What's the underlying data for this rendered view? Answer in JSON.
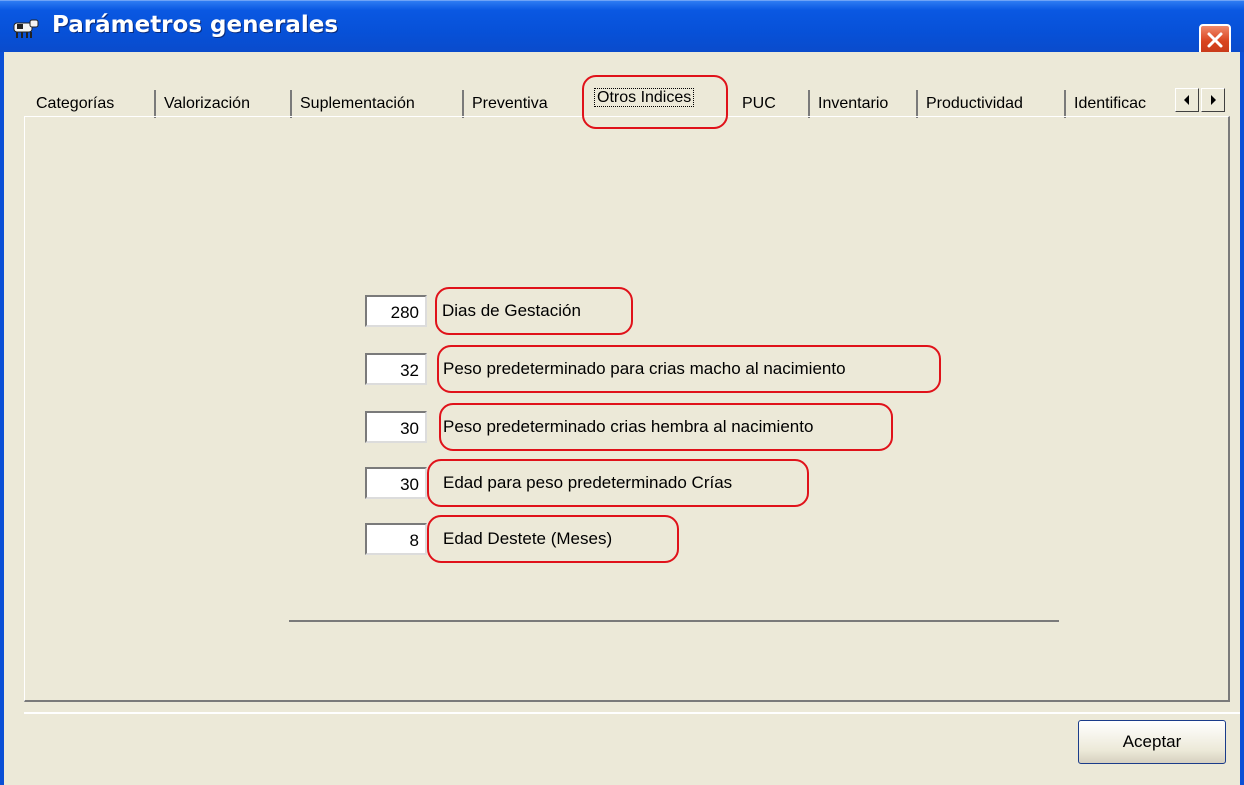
{
  "window": {
    "title": "Parámetros generales",
    "icon": "cow-icon",
    "close_icon": "close-icon"
  },
  "tabs": [
    {
      "label": "Categorías"
    },
    {
      "label": "Valorización"
    },
    {
      "label": "Suplementación"
    },
    {
      "label": "Preventiva"
    },
    {
      "label": "Otros Indices",
      "active": true
    },
    {
      "label": "PUC"
    },
    {
      "label": "Inventario"
    },
    {
      "label": "Productividad"
    },
    {
      "label": "Identificac"
    }
  ],
  "tab_scroll": {
    "left_icon": "arrow-left-icon",
    "right_icon": "arrow-right-icon"
  },
  "fields": [
    {
      "value": "280",
      "label": "Dias de Gestación"
    },
    {
      "value": "32",
      "label": "Peso predeterminado para crias macho al nacimiento"
    },
    {
      "value": "30",
      "label": "Peso predeterminado crias hembra al nacimiento"
    },
    {
      "value": "30",
      "label": "Edad para peso predeterminado Crías"
    },
    {
      "value": "8",
      "label": "Edad Destete (Meses)"
    }
  ],
  "buttons": {
    "accept": "Aceptar"
  },
  "colors": {
    "titlebar": "#0a58e2",
    "dialog_bg": "#ece9d8",
    "highlight": "#e0121a",
    "close": "#d9441f"
  }
}
